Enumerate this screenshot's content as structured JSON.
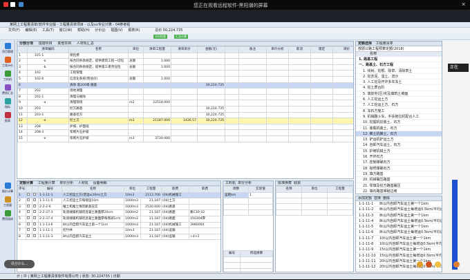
{
  "topbar": {
    "title": "您正在观看远程软件-黑阳潮的屏幕",
    "close": "✕"
  },
  "app": {
    "title": "某网上工程量清单(软件专业版 - 工程量清单项目 - 以及xx专业计算 - 04参考组",
    "menu": [
      "文件(F)",
      "编辑(E)",
      "工具(T)",
      "窗口(W)",
      "帮助(H)",
      "计价(J)",
      "视图(V)",
      "报表(R)"
    ],
    "green1": "计价检查",
    "green2": "汇总计算",
    "total": "总价 50,224.735"
  },
  "left_nav": [
    "项目管理",
    "工程计价",
    "工料机",
    "费用汇总",
    "指标",
    "报表",
    "工程文件",
    "审核"
  ],
  "left_nav_lower": [
    "报价计算",
    "工程量",
    "费用组成"
  ],
  "grid_tabs": [
    "分部分项",
    "措施项目",
    "其他项目",
    "人材机汇总"
  ],
  "grid_head": [
    "",
    "清单编码",
    "名称",
    "单位",
    "清单工程量",
    "清单单价",
    "金额(元)",
    "",
    "备注",
    "单价分析",
    "取消",
    "锁定",
    "调价"
  ],
  "grid_rows": [
    [
      "1",
      "101-1",
      "保险费",
      "",
      "",
      "",
      "",
      "",
      "",
      "",
      "",
      "",
      ""
    ],
    [
      "2",
      "-a",
      "按合同条款规定，提供建筑工程一切险",
      "总额",
      "1.000",
      "",
      "",
      "",
      "",
      "",
      "",
      "",
      ""
    ],
    [
      "3",
      "-b",
      "按合同条款规定，提供第三者责任险",
      "总额",
      "1.000",
      "",
      "",
      "",
      "",
      "",
      "",
      "",
      ""
    ],
    [
      "4",
      "102",
      "工程管理",
      "",
      "",
      "",
      "",
      "",
      "",
      "",
      "",
      "",
      ""
    ],
    [
      "5",
      "102-6",
      "信息化系统(暂估价)",
      "总额",
      "1.000",
      "",
      "",
      "",
      "",
      "",
      "",
      "",
      ""
    ],
    [
      "6",
      "",
      "清单 第200章 路基",
      "",
      "",
      "",
      "30,224.735",
      "",
      "",
      "",
      "",
      "",
      ""
    ],
    [
      "7",
      "202",
      "场地清理",
      "",
      "",
      "",
      "",
      "",
      "",
      "",
      "",
      "",
      ""
    ],
    [
      "8",
      "202-1",
      "清理与掘除",
      "",
      "",
      "",
      "",
      "",
      "",
      "",
      "",
      "",
      ""
    ],
    [
      "9",
      "-a",
      "清理现场",
      "m2",
      "22518.000",
      "",
      "",
      "",
      "",
      "",
      "",
      "",
      ""
    ],
    [
      "10",
      "203",
      "挖方路基",
      "",
      "",
      "",
      "30,224.735",
      "",
      "",
      "",
      "",
      "",
      ""
    ],
    [
      "11",
      "203-1",
      "路基挖方",
      "",
      "",
      "",
      "30,224.735",
      "",
      "",
      "",
      "",
      "",
      ""
    ],
    [
      "12",
      "-a",
      "挖土方",
      "m3",
      "21187.000",
      "1426.57",
      "30,224.735",
      "",
      "",
      "",
      "",
      "",
      ""
    ],
    [
      "13",
      "208",
      "护坡、护面墙",
      "",
      "",
      "",
      "",
      "",
      "",
      "",
      "",
      "",
      ""
    ],
    [
      "14",
      "208-3",
      "浆砌片石护坡",
      "",
      "",
      "",
      "",
      "",
      "",
      "",
      "",
      "",
      ""
    ],
    [
      "15",
      "-a",
      "浆砌片石护坡",
      "m3",
      "3730.000",
      "",
      "",
      "",
      "",
      "",
      "",
      "",
      ""
    ]
  ],
  "quota_tabs": [
    "定额计算",
    "工程量计算",
    "单价分析",
    "人材机",
    "设备明细"
  ],
  "quota_head": [
    "序号",
    "",
    "",
    "编号",
    "名称",
    "单位",
    "工程量",
    "取费",
    "取费",
    "单价"
  ],
  "quota_rows": [
    [
      "1",
      "",
      "",
      "1-1-11-1",
      "人工挖运土方(普运≤20m)土方",
      "10m3",
      "2113.700",
      "(04)机械施工",
      ""
    ],
    [
      "2",
      "",
      "",
      "1-1-11-5",
      "人工挖运土方每增运10m",
      "1000m3",
      "21.187",
      "(04)土方",
      ""
    ],
    [
      "3",
      "",
      "",
      "2-2-2-6",
      "推土机推土填筑路基压实",
      "1000m3",
      "2530.000",
      "(04)路基",
      ""
    ],
    [
      "4",
      "",
      "",
      "2-2-37-3",
      "轨道摊铺机铺筑混凝土路面厚20cm",
      "1000m2",
      "21.187",
      "(04)路面",
      "路C30-32"
    ],
    [
      "5",
      "",
      "",
      "2-2-37-4",
      "轨道摊铺机铺筑混凝土路面厚每增减1cm",
      "1000m2",
      "21.187",
      "(04)路面",
      "150304厚"
    ],
    [
      "6",
      "",
      "",
      "1-1-13-6",
      "8t以内自卸汽车运土第一个1km",
      "1000m3",
      "21.187",
      "(04)机械施工",
      "3980004"
    ],
    [
      "7",
      "",
      "",
      "1-1-11-1",
      "挖竹林",
      "10m3",
      "21.187",
      "(04)运输",
      ""
    ],
    [
      "8",
      "",
      "",
      "1-1-11-3",
      "8t以内自卸汽车运土",
      "1000m3",
      "21.187",
      "(04)运输",
      "+4×2"
    ]
  ],
  "mid": {
    "tabs": [
      "工料机",
      "单价分析",
      "标准换算",
      "取费"
    ],
    "h1": "调整",
    "h2": "实际值",
    "r1": "运距km",
    "r2": "1",
    "h3": "名称",
    "h4": "单位",
    "h5": "工程量",
    "bottom_h": [
      "编号",
      "所选换算"
    ]
  },
  "right": {
    "tabs": [
      "定额选择",
      "工程量清单"
    ],
    "dropdown": "部颁公路工程预算定额(2018)",
    "search": "查询",
    "btns": [
      "选择定额",
      "条件查询",
      "模板",
      "导入"
    ],
    "list_head": "名称",
    "list": [
      "1. 路基工程",
      "一、路基土、石方工程",
      "1. 伐树、挖根、除草、清除表土",
      "2. 挖淤泥、湿土、流沙",
      "3. 人工挖及开炸多年冻土",
      "4. 挖土质台阶",
      "5. 填前夯(压)实及填筑土坡面",
      "6. 人工挖运土方",
      "7. 人工挖运土方、石方",
      "8. 冻石方施工",
      "9. 机械翻斗车、手扶拖拉机配合人工",
      "10. 挖掘机挖装土、石方",
      "11. 装载机装土、石方",
      "12. 推土机推土、石方",
      "13. 铲运机铲运土方",
      "14. 自卸汽车运土、石方",
      "15. 护坡机械土方",
      "16. 开炸石方",
      "17. 控制爆破石方",
      "18. 抛坍爆破石方",
      "19. 填方路基",
      "20. 机械碾压路基",
      "21. 零填及挖方路基碾压",
      "22. 填石路基堆砌边坡",
      "23. 石灰改良土",
      "24. 整修路基",
      "25. 挖截水沟、边沟、排水、截..."
    ]
  },
  "rp2": {
    "tabs": [
      "添加定额",
      "子目",
      "替换",
      "编辑",
      "删除"
    ],
    "rows": [
      [
        "1-1-11-1",
        "8t以内自卸汽车运土第一个1km"
      ],
      [
        "1-1-11-2",
        "8t以内自卸汽车运土每增运0.5km(平均运"
      ],
      [
        "1-1-11-3",
        "8t以内自卸汽车运土第一个1km"
      ],
      [
        "1-1-11-4",
        "8t以内自卸汽车运土每增运0.5km(平均运"
      ],
      [
        "1-1-11-5",
        "6t以内自卸汽车运土第一个1km"
      ],
      [
        "1-1-11-6",
        "8t以内自卸汽车运土每增运0.5km(平均运"
      ],
      [
        "1-1-11-7",
        "10t以内自卸汽车运土第一个1km"
      ],
      [
        "1-1-11-8",
        "10t以内自卸汽车运土每增运0.5km(平均运"
      ],
      [
        "1-1-11-9",
        "15t以内自卸汽车运土第一个1km"
      ],
      [
        "1-1-11-10",
        "15t以内自卸汽车运土每增运0.5km(平均运"
      ],
      [
        "1-1-11-11",
        "20t以内自卸汽车运土第一个1km"
      ],
      [
        "1-1-11-12",
        "20t以内自卸汽车运土每增运0.5km(平均运"
      ]
    ]
  },
  "overlay": "讯分计么...",
  "status": "计 | 中 | 某网上工程量清单软件有限公司 | 状态: 30.224735 | 日期",
  "side": "正在"
}
